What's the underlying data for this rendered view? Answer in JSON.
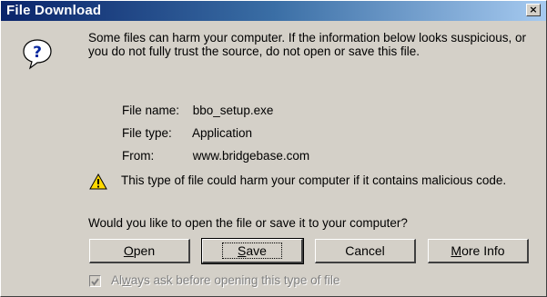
{
  "window": {
    "title": "File Download",
    "close_glyph": "×"
  },
  "message": "Some files can harm your computer. If the information below looks suspicious, or you do not fully trust the source, do not open or save this file.",
  "file_info": {
    "name_label": "File name:",
    "name_value": "bbo_setup.exe",
    "type_label": "File type:",
    "type_value": "Application",
    "from_label": "From:",
    "from_value": "www.bridgebase.com"
  },
  "warning": "This type of file could harm your computer if it contains malicious code.",
  "question": "Would you like to open the file or save it to your computer?",
  "buttons": {
    "open": {
      "accel": "O",
      "rest": "pen"
    },
    "save": {
      "accel": "S",
      "rest": "ave"
    },
    "cancel": "Cancel",
    "more_info": {
      "accel": "M",
      "rest": "ore Info"
    }
  },
  "checkbox": {
    "checked": true,
    "label_pre": "Al",
    "label_accel": "w",
    "label_post": "ays ask before opening this type of file"
  },
  "icons": {
    "question": "question-icon",
    "warning": "warning-icon",
    "close": "close-icon"
  },
  "colors": {
    "title_bar_start": "#0a246a",
    "title_bar_end": "#a6caf0",
    "dialog_bg": "#d4d0c8"
  }
}
